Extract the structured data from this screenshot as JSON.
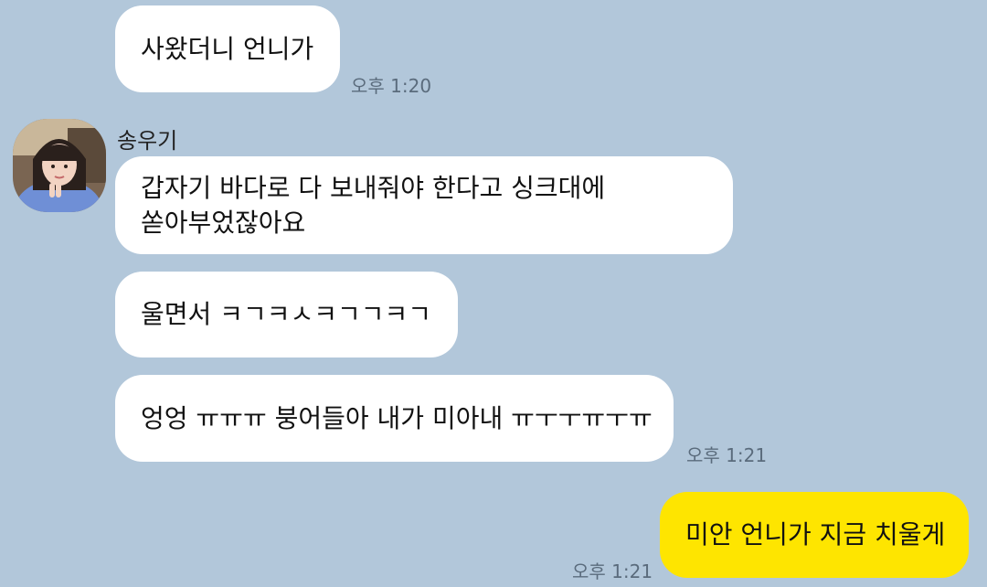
{
  "chat": {
    "messages": [
      {
        "text": "사왔더니 언니가",
        "time": "오후 1:20"
      },
      {
        "sender": "송우기",
        "lines": [
          "갑자기 바다로 다 보내줘야 한다고 싱크대에",
          "쏟아부었잖아요"
        ]
      },
      {
        "text": "울면서 ㅋㄱㅋㅅㅋㄱㄱㅋㄱ"
      },
      {
        "text": "엉엉 ㅠㅠㅠ 붕어들아 내가 미아내 ㅠㅜㅜㅠㅜㅠ",
        "time": "오후 1:21"
      },
      {
        "text": "미안 언니가 지금 치울게",
        "time": "오후 1:21",
        "mine": true
      }
    ]
  },
  "colors": {
    "background": "#b2c7da",
    "bubble_other": "#ffffff",
    "bubble_mine": "#fee500",
    "time_text": "#5a6b7c"
  }
}
